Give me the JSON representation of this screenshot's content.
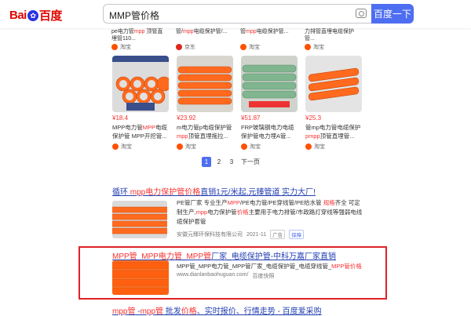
{
  "header": {
    "logo_bai": "Bai",
    "logo_du": "du",
    "logo_cn": "百度",
    "query": "MMP管价格",
    "search_button": "百度一下",
    "camera_icon": "camera-icon"
  },
  "top_strip": [
    {
      "title_pre": "pe电力管",
      "title_em": "mpp",
      "title_post": " 顶管直埋管110...",
      "source": "淘宝"
    },
    {
      "title_pre": "管/",
      "title_em": "mpp",
      "title_post": "电缆保护管/...",
      "source": "京东"
    },
    {
      "title_pre": "管",
      "title_em": "mpp",
      "title_post": "电缆保护管...",
      "source": "淘宝"
    },
    {
      "title_pre": "力排管直埋",
      "title_em": "",
      "title_post": "电缆保护管...",
      "source": "淘宝"
    }
  ],
  "products": [
    {
      "price": "¥18.4",
      "title_pre": "MPP电力管",
      "title_em": "MPP",
      "title_post": "电缆保护管 MPP开挖管...",
      "source": "淘宝",
      "img_text": "非开挖顶管"
    },
    {
      "price": "¥23.92",
      "title_pre": "m电力管p电缆保护管",
      "title_em": "mpp",
      "title_post": "顶管直埋拖拉...",
      "source": "淘宝"
    },
    {
      "price": "¥51.87",
      "title_pre": "FRP玻璃钢电力电缆保护管电力埋A管...",
      "title_em": "",
      "title_post": "",
      "source": "淘宝"
    },
    {
      "price": "¥25.3",
      "title_pre": "管mp电力管电缆保护",
      "title_em": "pmpp",
      "title_post": "顶管直埋管...",
      "source": "淘宝"
    }
  ],
  "pager": {
    "p1": "1",
    "p2": "2",
    "p3": "3",
    "next": "下一页"
  },
  "result1": {
    "title_a": "循环 ",
    "title_em1": "mpp电力保护管价格",
    "title_b": "直销1元/米起,元臻管道 实力大厂!",
    "desc_a": "PE管厂家 专业生产",
    "desc_em1": "MPP",
    "desc_b": "/PE电力管/PE穿线管/PE给水管 ",
    "desc_em2": "规格",
    "desc_c": "齐全 可定制生产,",
    "desc_em3": "mpp",
    "desc_d": "电力保护管",
    "desc_em4": "价格",
    "desc_e": "主要用于电力排管/市政路灯穿线等强弱电线缆保护套管",
    "company": "安徽元臻环保科技有限公司",
    "date": "2021-11",
    "ad": "广告",
    "bao": "保障"
  },
  "result2": {
    "title_em1": "MPP管",
    "title_b": "_",
    "title_em2": "MPP电力管",
    "title_c": "_",
    "title_em3": "MPP管",
    "title_d": "厂家_电缆保护管-中科万嘉厂家直销",
    "desc_a": "MPP管_MPP电力管_MPP管厂家_电缆保护管_电缆穿线管_",
    "desc_em": "MPP管价格",
    "url": "www.dianlanbaohuguan.com/",
    "snapshot": "百度快照"
  },
  "result3": {
    "title_em1": "mpp管",
    "title_b": " -",
    "title_em2": "mpp管",
    "title_c": " 批发",
    "title_em3": "价格",
    "title_d": "、实时报价、行情走势 - 百度爱采购"
  },
  "colors": {
    "accent": "#4e6ef2",
    "link": "#2440b3",
    "highlight": "#f73131",
    "frame": "#e02127",
    "pipe": "#ff6a1f"
  }
}
